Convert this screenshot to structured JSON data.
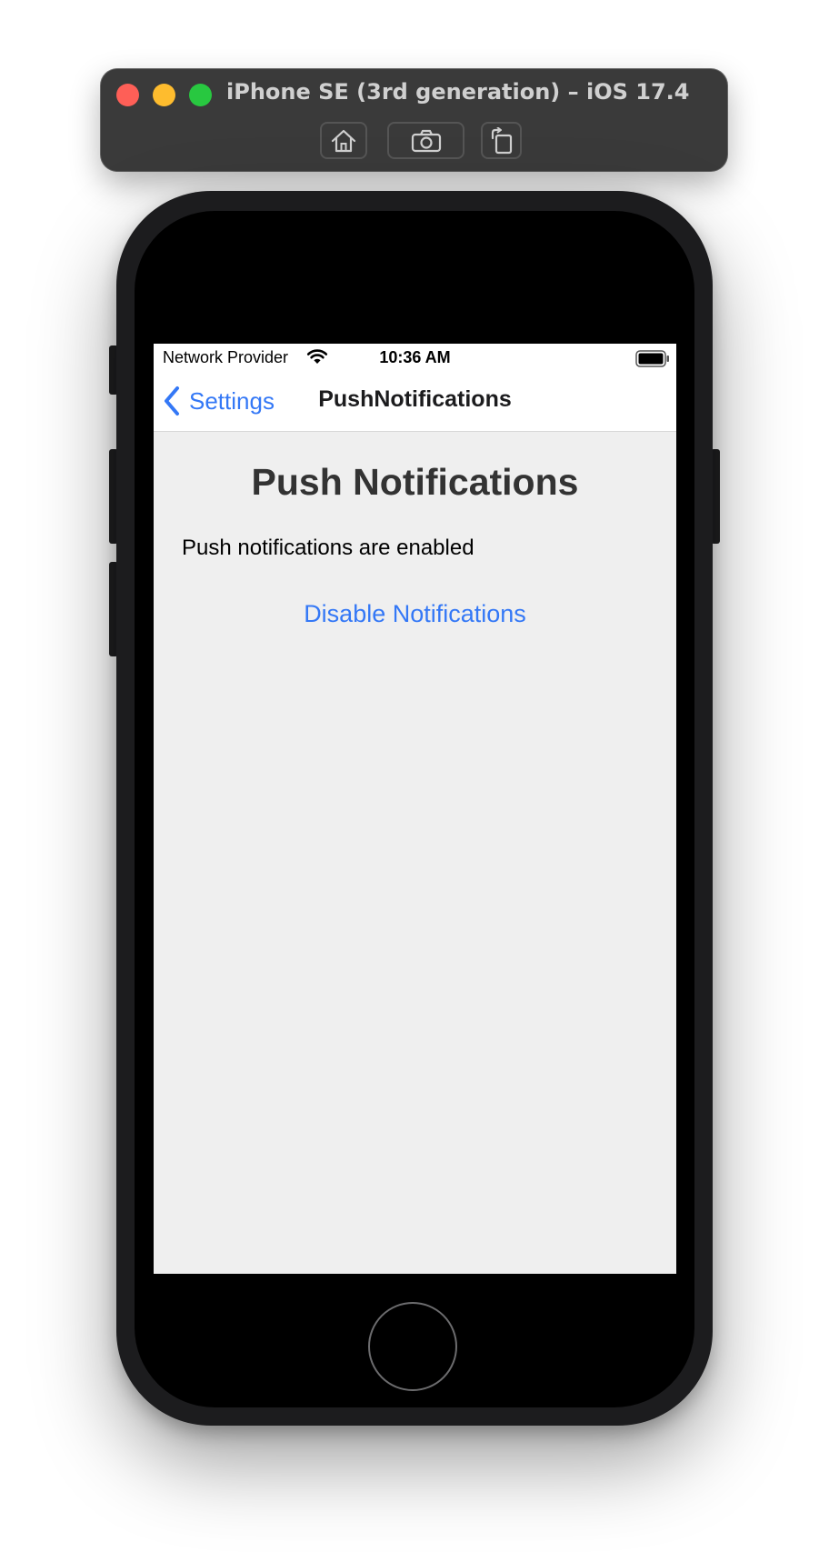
{
  "simulator": {
    "title": "iPhone SE (3rd generation) – iOS 17.4",
    "buttons": [
      {
        "label": "Home",
        "icon": "home-icon"
      },
      {
        "label": "Screenshot",
        "icon": "camera-icon"
      },
      {
        "label": "Rotate",
        "icon": "rotate-icon"
      }
    ],
    "traffic_colors": {
      "close": "#fe5f57",
      "minimize": "#febc2e",
      "maximize": "#28c840"
    }
  },
  "status_bar": {
    "carrier": "Network Provider",
    "time": "10:36 AM",
    "wifi_icon": "wifi-icon",
    "battery_icon": "battery-icon"
  },
  "nav": {
    "back_label": "Settings",
    "back_icon": "chevron-left-icon",
    "title": "PushNotifications"
  },
  "content": {
    "heading": "Push Notifications",
    "status_text": "Push notifications are enabled",
    "action_label": "Disable Notifications"
  },
  "colors": {
    "accent": "#3478f6",
    "screen_background": "#efefef",
    "heading": "#333333"
  }
}
